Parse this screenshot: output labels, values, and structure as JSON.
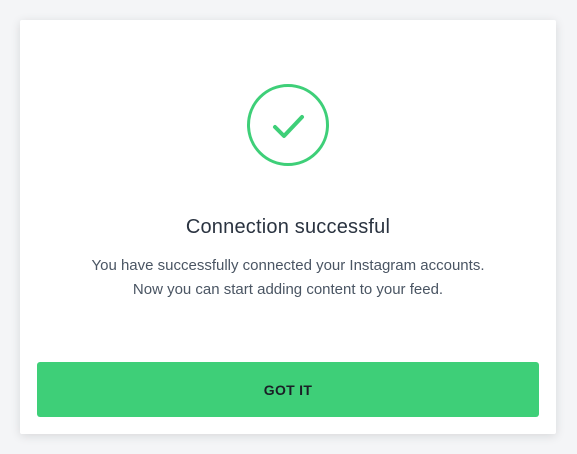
{
  "dialog": {
    "title": "Connection successful",
    "message_line1": "You have successfully connected your Instagram accounts.",
    "message_line2": "Now you can start adding content to your feed.",
    "button_label": "GOT IT",
    "icon": "check-circle-icon"
  },
  "colors": {
    "accent": "#3ecf78",
    "text": "#2a3340",
    "muted_text": "#4a5563",
    "background": "#f4f5f7",
    "card": "#ffffff"
  }
}
